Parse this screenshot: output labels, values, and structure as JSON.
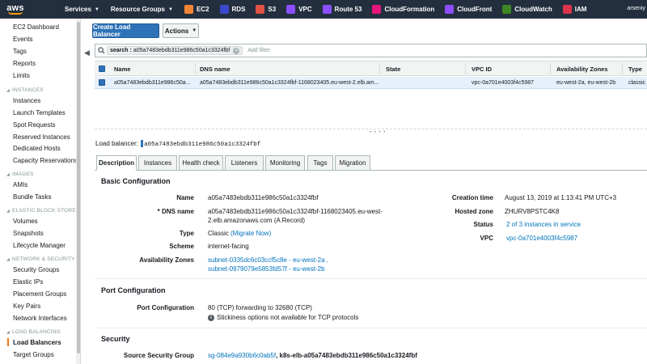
{
  "topnav": {
    "logo": "aws",
    "services": "Services",
    "resource_groups": "Resource Groups",
    "shortcuts": [
      {
        "label": "EC2",
        "color": "#f58536",
        "icon": "ec2-icon"
      },
      {
        "label": "RDS",
        "color": "#3b48cc",
        "icon": "rds-icon"
      },
      {
        "label": "S3",
        "color": "#e05243",
        "icon": "s3-icon"
      },
      {
        "label": "VPC",
        "color": "#8c4fff",
        "icon": "vpc-icon"
      },
      {
        "label": "Route 53",
        "color": "#8c4fff",
        "icon": "route53-icon"
      },
      {
        "label": "CloudFormation",
        "color": "#e7157b",
        "icon": "cloudformation-icon"
      },
      {
        "label": "CloudFront",
        "color": "#8c4fff",
        "icon": "cloudfront-icon"
      },
      {
        "label": "CloudWatch",
        "color": "#3f8624",
        "icon": "cloudwatch-icon"
      },
      {
        "label": "IAM",
        "color": "#dd344c",
        "icon": "iam-icon"
      }
    ],
    "user": "arseniy"
  },
  "sidebar": {
    "top_items": [
      "EC2 Dashboard",
      "Events",
      "Tags",
      "Reports",
      "Limits"
    ],
    "instances_header": "INSTANCES",
    "instances_items": [
      "Instances",
      "Launch Templates",
      "Spot Requests",
      "Reserved Instances",
      "Dedicated Hosts",
      "Capacity Reservations"
    ],
    "images_header": "IMAGES",
    "images_items": [
      "AMIs",
      "Bundle Tasks"
    ],
    "ebs_header": "ELASTIC BLOCK STORE",
    "ebs_items": [
      "Volumes",
      "Snapshots",
      "Lifecycle Manager"
    ],
    "network_header": "NETWORK & SECURITY",
    "network_items": [
      "Security Groups",
      "Elastic IPs",
      "Placement Groups",
      "Key Pairs",
      "Network Interfaces"
    ],
    "lb_header": "LOAD BALANCING",
    "lb_items": [
      "Load Balancers",
      "Target Groups"
    ]
  },
  "toolbar": {
    "create_label": "Create Load Balancer",
    "actions_label": "Actions"
  },
  "search": {
    "token_key": "search :",
    "token_value": "a05a7483ebdb311e986c50a1c3324fbf",
    "add_filter": "Add filter"
  },
  "table": {
    "columns": [
      "Name",
      "DNS name",
      "State",
      "VPC ID",
      "Availability Zones",
      "Type"
    ],
    "row": {
      "name": "a05a7483ebdb311e986c50a...",
      "dns": "a05a7483ebdb311e986c50a1c3324fbf-1168023405.eu-west-2.elb.am...",
      "state": "",
      "vpc": "vpc-0a701e4003f4c5987",
      "azs": "eu-west-2a, eu-west-2b",
      "type": "classic"
    }
  },
  "details": {
    "lb_prefix": "Load balancer:",
    "lb_name": "a05a7483ebdb311e986c50a1c3324fbf",
    "tabs": [
      "Description",
      "Instances",
      "Health check",
      "Listeners",
      "Monitoring",
      "Tags",
      "Migration"
    ],
    "basic_title": "Basic Configuration",
    "name_label": "Name",
    "name_value": "a05a7483ebdb311e986c50a1c3324fbf",
    "dns_label": "* DNS name",
    "dns_value_1": "a05a7483ebdb311e986c50a1c3324fbf-1168023405.eu-west-",
    "dns_value_2": "2.elb.amazonaws.com (A Record)",
    "type_label": "Type",
    "type_value": "Classic",
    "type_link": "(Migrate Now)",
    "scheme_label": "Scheme",
    "scheme_value": "internet-facing",
    "az_label": "Availability Zones",
    "az_value_1": "subnet-0335dc6c03ccf5c8e - eu-west-2a ,",
    "az_value_2": "subnet-0979079e5853fd57f - eu-west-2b",
    "created_label": "Creation time",
    "created_value": "August 13, 2019 at 1:13:41 PM UTC+3",
    "zone_label": "Hosted zone",
    "zone_value": "ZHURV8PSTC4K8",
    "status_label": "Status",
    "status_value": "2 of 3 instances in service",
    "vpc_label": "VPC",
    "vpc_value": "vpc-0a701e4003f4c5987",
    "port_title": "Port Configuration",
    "port_label": "Port Configuration",
    "port_value": "80 (TCP) forwarding to 32680 (TCP)",
    "stickiness": "Stickiness options not available for TCP protocols",
    "security_title": "Security",
    "sg_label": "Source Security Group",
    "sg_link": "sg-084e9a930b6c0ab5f",
    "sg_value": ", k8s-elb-a05a7483ebdb311e986c50a1c3324fbf"
  }
}
